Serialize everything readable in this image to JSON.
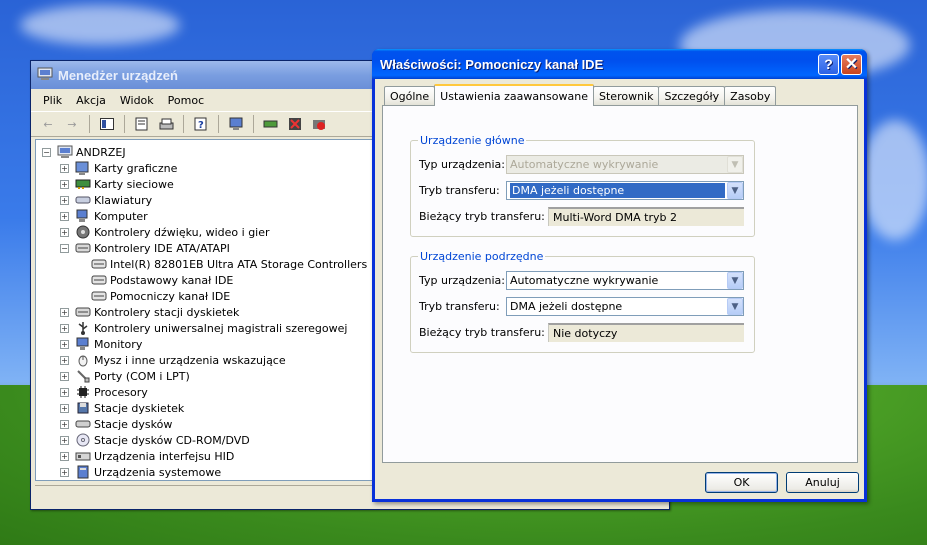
{
  "device_manager": {
    "title": "Menedżer urządzeń",
    "menu": [
      "Plik",
      "Akcja",
      "Widok",
      "Pomoc"
    ],
    "tree_root": "ANDRZEJ",
    "tree": [
      {
        "label": "Karty graficzne",
        "icon": "display-adapter-icon",
        "level": 1,
        "expander": "+"
      },
      {
        "label": "Karty sieciowe",
        "icon": "network-adapter-icon",
        "level": 1,
        "expander": "+"
      },
      {
        "label": "Klawiatury",
        "icon": "keyboard-icon",
        "level": 1,
        "expander": "+"
      },
      {
        "label": "Komputer",
        "icon": "computer-icon",
        "level": 1,
        "expander": "+"
      },
      {
        "label": "Kontrolery dźwięku, wideo i gier",
        "icon": "sound-icon",
        "level": 1,
        "expander": "+"
      },
      {
        "label": "Kontrolery IDE ATA/ATAPI",
        "icon": "ide-controller-icon",
        "level": 1,
        "expander": "−"
      },
      {
        "label": "Intel(R) 82801EB Ultra ATA Storage Controllers",
        "icon": "ide-channel-icon",
        "level": 2,
        "expander": ""
      },
      {
        "label": "Podstawowy kanał IDE",
        "icon": "ide-channel-icon",
        "level": 2,
        "expander": ""
      },
      {
        "label": "Pomocniczy kanał IDE",
        "icon": "ide-channel-icon",
        "level": 2,
        "expander": ""
      },
      {
        "label": "Kontrolery stacji dyskietek",
        "icon": "floppy-controller-icon",
        "level": 1,
        "expander": "+"
      },
      {
        "label": "Kontrolery uniwersalnej magistrali szeregowej",
        "icon": "usb-icon",
        "level": 1,
        "expander": "+"
      },
      {
        "label": "Monitory",
        "icon": "monitor-icon",
        "level": 1,
        "expander": "+"
      },
      {
        "label": "Mysz i inne urządzenia wskazujące",
        "icon": "mouse-icon",
        "level": 1,
        "expander": "+"
      },
      {
        "label": "Porty (COM i LPT)",
        "icon": "port-icon",
        "level": 1,
        "expander": "+"
      },
      {
        "label": "Procesory",
        "icon": "processor-icon",
        "level": 1,
        "expander": "+"
      },
      {
        "label": "Stacje dyskietek",
        "icon": "floppy-drive-icon",
        "level": 1,
        "expander": "+"
      },
      {
        "label": "Stacje dysków",
        "icon": "disk-drive-icon",
        "level": 1,
        "expander": "+"
      },
      {
        "label": "Stacje dysków CD-ROM/DVD",
        "icon": "cdrom-icon",
        "level": 1,
        "expander": "+"
      },
      {
        "label": "Urządzenia interfejsu HID",
        "icon": "hid-icon",
        "level": 1,
        "expander": "+"
      },
      {
        "label": "Urządzenia systemowe",
        "icon": "system-device-icon",
        "level": 1,
        "expander": "+"
      }
    ]
  },
  "dialog": {
    "title": "Właściwości: Pomocniczy kanał IDE",
    "tabs": [
      "Ogólne",
      "Ustawienia zaawansowane",
      "Sterownik",
      "Szczegóły",
      "Zasoby"
    ],
    "active_tab": 1,
    "master": {
      "group_label": "Urządzenie główne",
      "device_type_label": "Typ urządzenia:",
      "device_type_value": "Automatyczne wykrywanie",
      "transfer_mode_label": "Tryb transferu:",
      "transfer_mode_value": "DMA jeżeli dostępne",
      "current_mode_label": "Bieżący tryb transferu:",
      "current_mode_value": "Multi-Word DMA tryb 2"
    },
    "slave": {
      "group_label": "Urządzenie podrzędne",
      "device_type_label": "Typ urządzenia:",
      "device_type_value": "Automatyczne wykrywanie",
      "transfer_mode_label": "Tryb transferu:",
      "transfer_mode_value": "DMA jeżeli dostępne",
      "current_mode_label": "Bieżący tryb transferu:",
      "current_mode_value": "Nie dotyczy"
    },
    "ok_label": "OK",
    "cancel_label": "Anuluj"
  },
  "colors": {
    "title_bar": "#0053ee",
    "selection": "#316ac5",
    "group_label": "#0046d5",
    "tab_highlight": "#ffc83c"
  }
}
